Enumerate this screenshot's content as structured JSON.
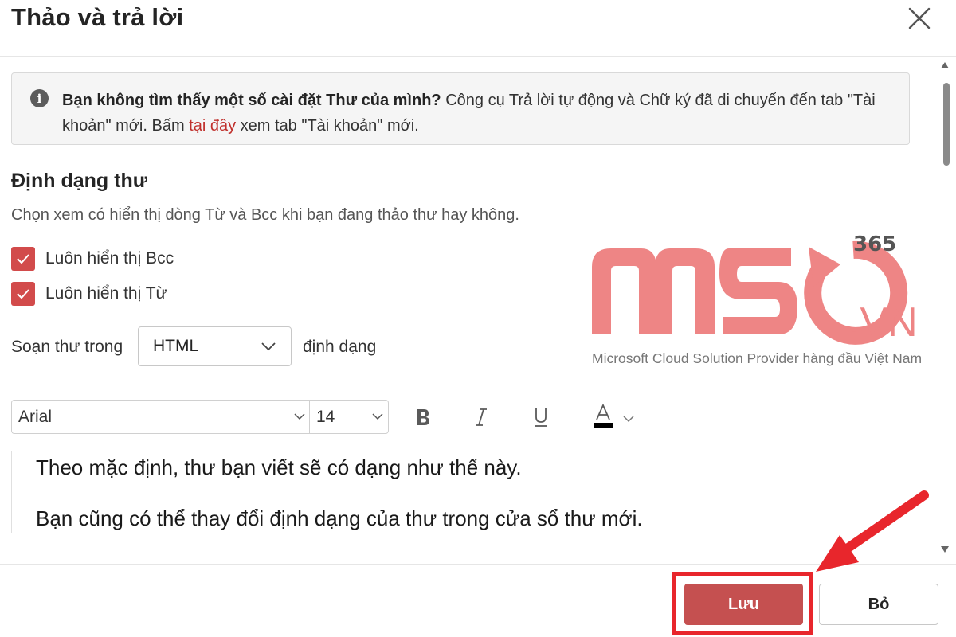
{
  "dialog": {
    "title": "Thảo và trả lời",
    "close_icon": "close-icon"
  },
  "banner": {
    "icon": "info-icon",
    "bold_text": "Bạn không tìm thấy một số cài đặt Thư của mình?",
    "text_1": " Công cụ Trả lời tự động và Chữ ký đã di chuyển đến tab \"Tài khoản\" mới. Bấm ",
    "link_text": "tại đây",
    "text_2": " xem tab \"Tài khoản\" mới.",
    "link_color": "#c0302c"
  },
  "section": {
    "title": "Định dạng thư",
    "description": "Chọn xem có hiển thị dòng Từ và Bcc khi bạn đang thảo thư hay không.",
    "checkboxes": [
      {
        "label": "Luôn hiển thị Bcc",
        "checked": true
      },
      {
        "label": "Luôn hiển thị Từ",
        "checked": true
      }
    ],
    "checkbox_color": "#d24b4b",
    "compose_prefix": "Soạn thư trong",
    "compose_format": "HTML",
    "compose_suffix": "định dạng"
  },
  "toolbar": {
    "font": "Arial",
    "size": "14",
    "bold_icon": "bold-icon",
    "italic_icon": "italic-icon",
    "underline_icon": "underline-icon",
    "font_color_icon": "font-color-icon"
  },
  "editor": {
    "lines": [
      "Theo mặc định, thư bạn viết sẽ có dạng như thế này.",
      "Bạn cũng có thể thay đổi định dạng của thư trong cửa sổ thư mới."
    ]
  },
  "footer": {
    "save_label": "Lưu",
    "discard_label": "Bỏ",
    "save_color": "#c55050",
    "highlight_color": "#e8262c"
  },
  "watermark": {
    "brand": "MSO",
    "superscript": "365",
    "domain": ".VN",
    "tagline": "Microsoft Cloud Solution Provider hàng đầu Việt Nam",
    "color": "#ee8585"
  }
}
